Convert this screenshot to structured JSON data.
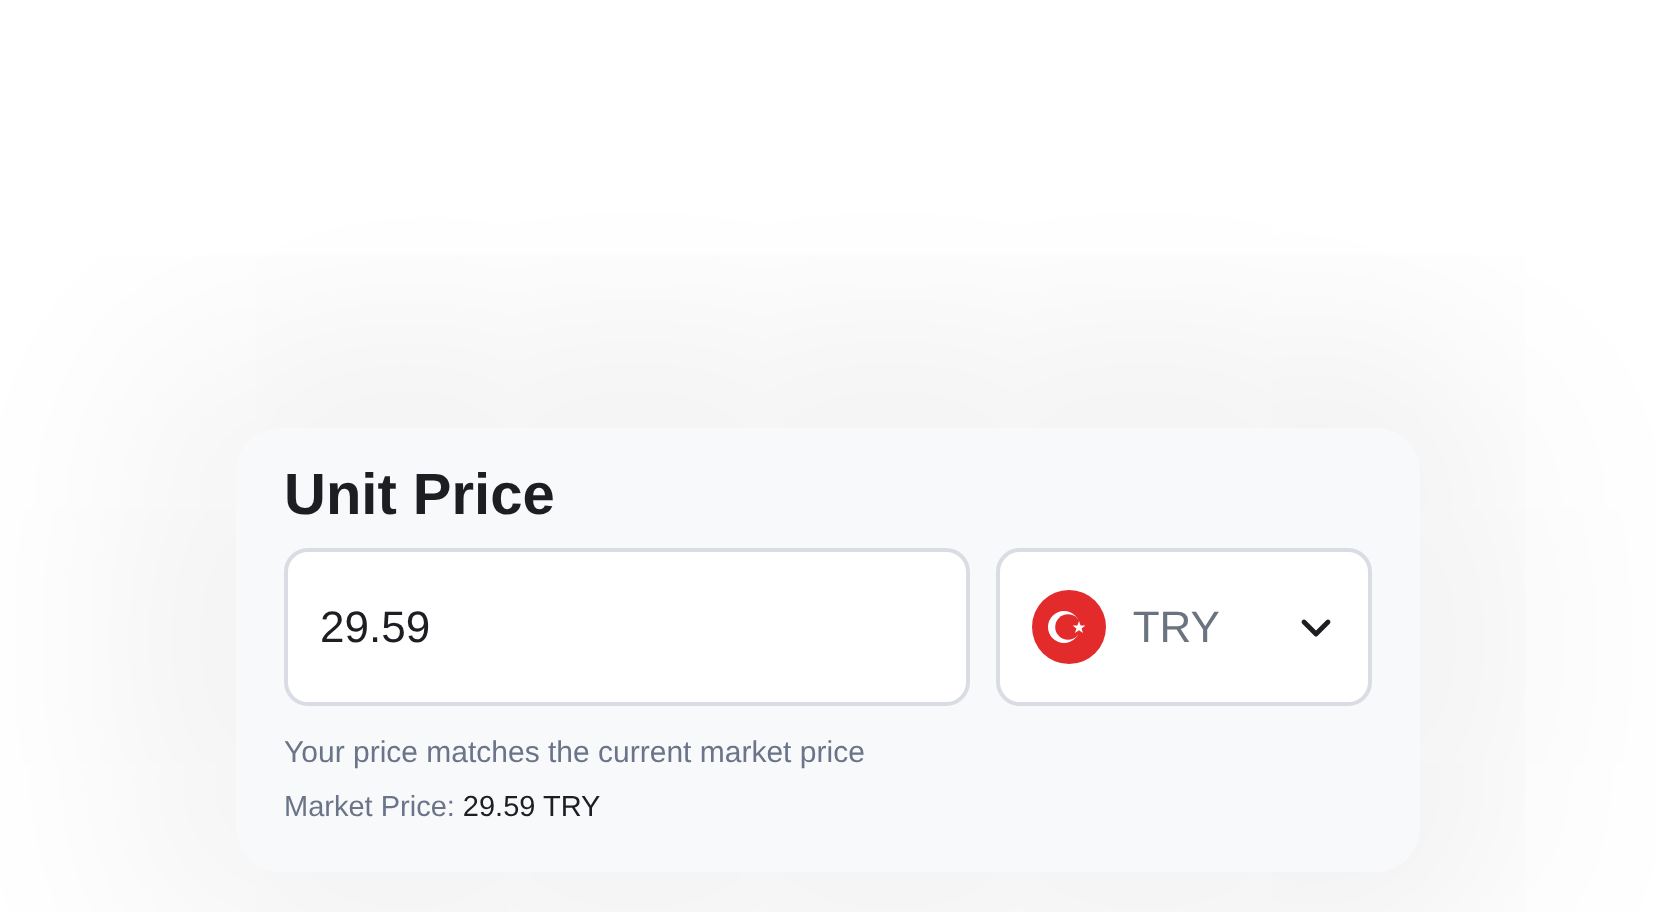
{
  "title": "Unit Price",
  "price_input": {
    "value": "29.59"
  },
  "currency_select": {
    "value": "TRY"
  },
  "hint": "Your price matches the current market price",
  "market_price": {
    "label": "Market Price:",
    "value": "29.59 TRY"
  }
}
